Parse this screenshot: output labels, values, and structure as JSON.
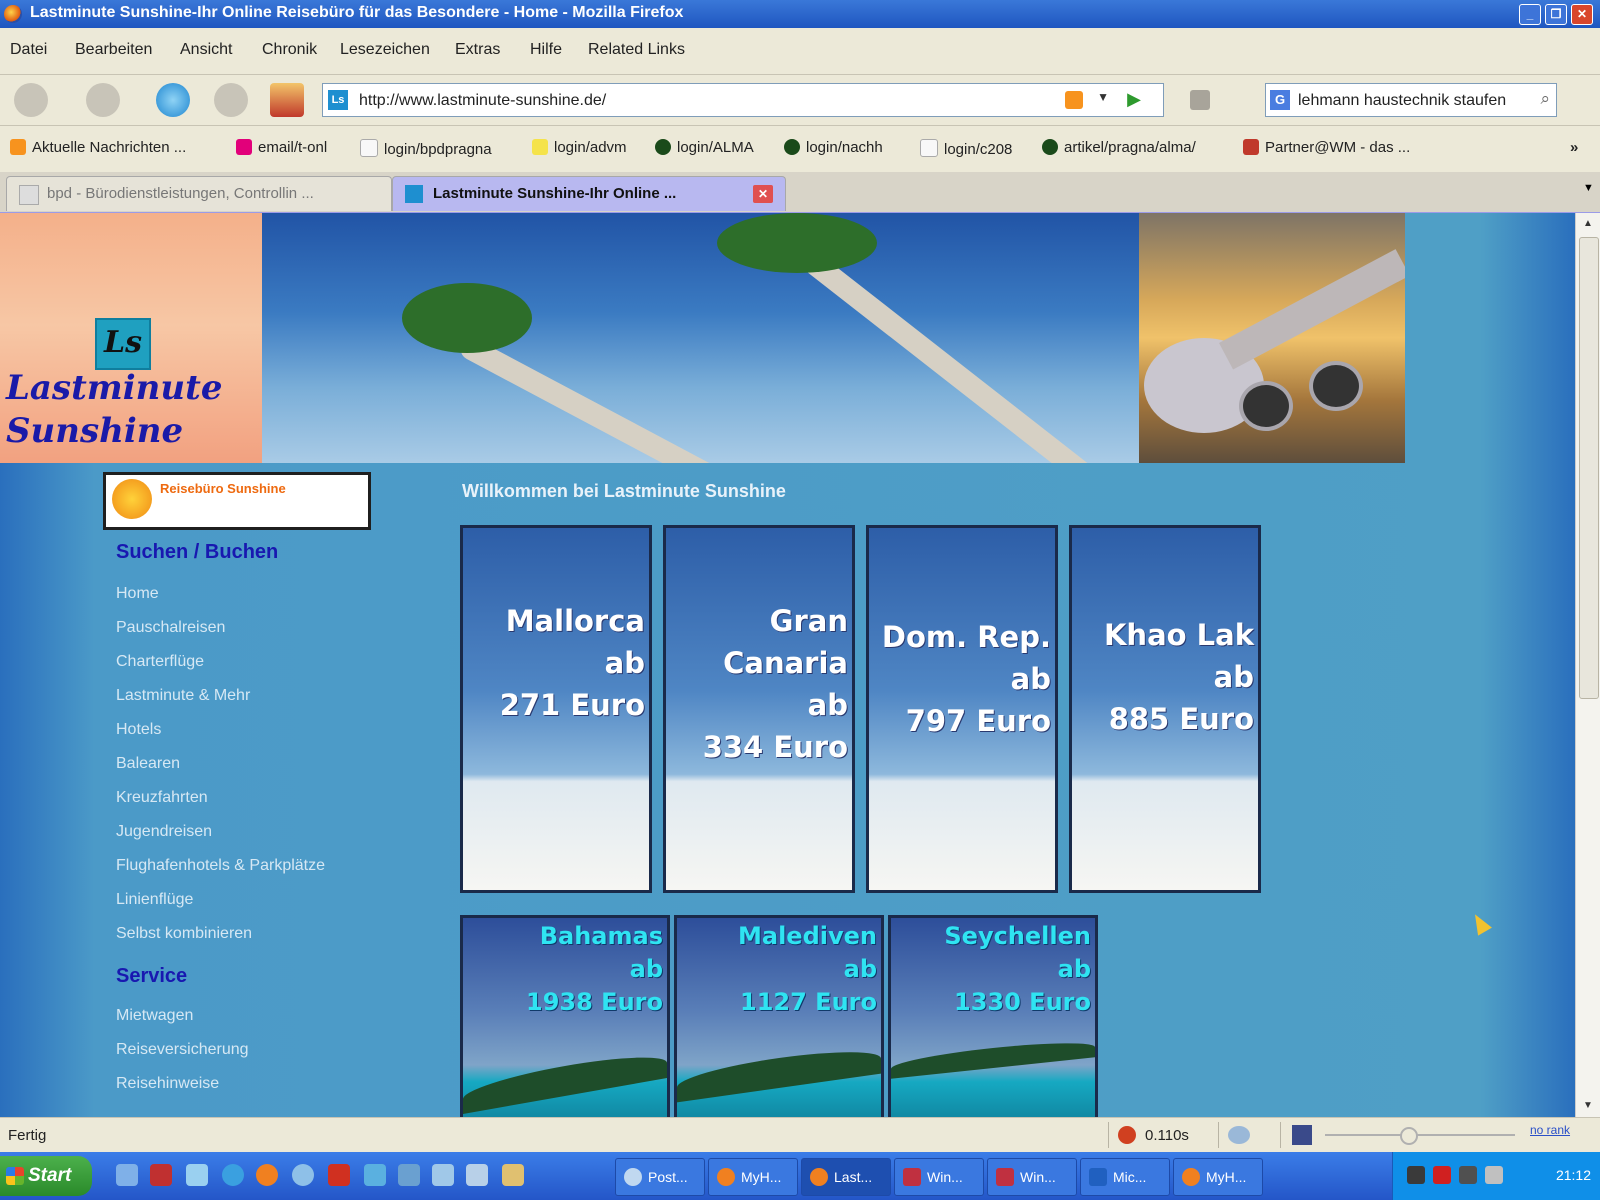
{
  "window": {
    "title": "Lastminute Sunshine-Ihr Online Reisebüro für das Besondere - Home - Mozilla Firefox"
  },
  "menu": [
    "Datei",
    "Bearbeiten",
    "Ansicht",
    "Chronik",
    "Lesezeichen",
    "Extras",
    "Hilfe",
    "Related Links"
  ],
  "toolbar": {
    "url": "http://www.lastminute-sunshine.de/",
    "search_value": "lehmann haustechnik staufen"
  },
  "bookmarks": [
    "Aktuelle Nachrichten ...",
    "email/t-onl",
    "login/bpdpragna",
    "login/advm",
    "login/ALMA",
    "login/nachh",
    "login/c208",
    "artikel/pragna/alma/",
    "Partner@WM - das ..."
  ],
  "tabs": [
    {
      "label": "bpd - Bürodienstleistungen, Controllin ..."
    },
    {
      "label": "Lastminute Sunshine-Ihr Online ..."
    }
  ],
  "page": {
    "logo": {
      "icon": "Ls",
      "line1": "Lastminute",
      "line2": "Sunshine"
    },
    "partner_banner": {
      "title": "Reisebüro Sunshine"
    },
    "sidebar": {
      "section1": "Suchen / Buchen",
      "items1": [
        "Home",
        "Pauschalreisen",
        "Charterflüge",
        "Lastminute & Mehr",
        "Hotels",
        "Balearen",
        "Kreuzfahrten",
        "Jugendreisen",
        "Flughafenhotels & Parkplätze",
        "Linienflüge",
        "Selbst kombinieren"
      ],
      "section2": "Service",
      "items2": [
        "Mietwagen",
        "Reiseversicherung",
        "Reisehinweise"
      ]
    },
    "welcome": "Willkommen bei Lastminute Sunshine",
    "deals_row1": [
      {
        "lines": [
          "Mallorca",
          "ab",
          "271 Euro"
        ]
      },
      {
        "lines": [
          "Gran",
          "Canaria",
          "ab",
          "334 Euro"
        ]
      },
      {
        "lines": [
          "Dom. Rep.",
          "ab",
          "797 Euro"
        ]
      },
      {
        "lines": [
          "Khao Lak",
          "ab",
          "885 Euro"
        ]
      }
    ],
    "deals_row2": [
      {
        "lines": [
          "Bahamas",
          "ab",
          "1938 Euro"
        ]
      },
      {
        "lines": [
          "Malediven",
          "ab",
          "1127 Euro"
        ]
      },
      {
        "lines": [
          "Seychellen",
          "ab",
          "1330 Euro"
        ]
      }
    ]
  },
  "statusbar": {
    "status": "Fertig",
    "time": "0.110s",
    "rank": "no rank"
  },
  "taskbar": {
    "start": "Start",
    "tasks": [
      "Post...",
      "MyH...",
      "Last...",
      "Win...",
      "Win...",
      "Mic...",
      "MyH..."
    ],
    "clock": "21:12"
  }
}
